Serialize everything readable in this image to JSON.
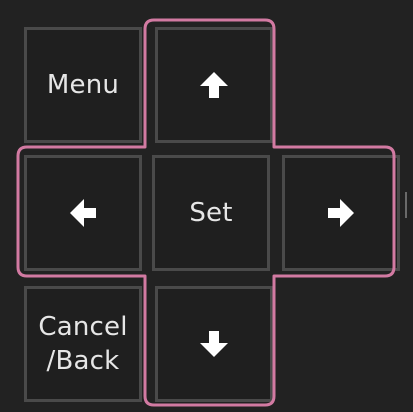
{
  "controls": {
    "menu_label": "Menu",
    "set_label": "Set",
    "cancel_line1": "Cancel",
    "cancel_line2": "/Back"
  },
  "icons": {
    "up": "arrow-up-icon",
    "down": "arrow-down-icon",
    "left": "arrow-left-icon",
    "right": "arrow-right-icon"
  },
  "colors": {
    "background": "#222222",
    "button_fill": "#1f1f1f",
    "button_border": "#4a4a4a",
    "text": "#e6e6e6",
    "highlight": "#d27aa2"
  }
}
